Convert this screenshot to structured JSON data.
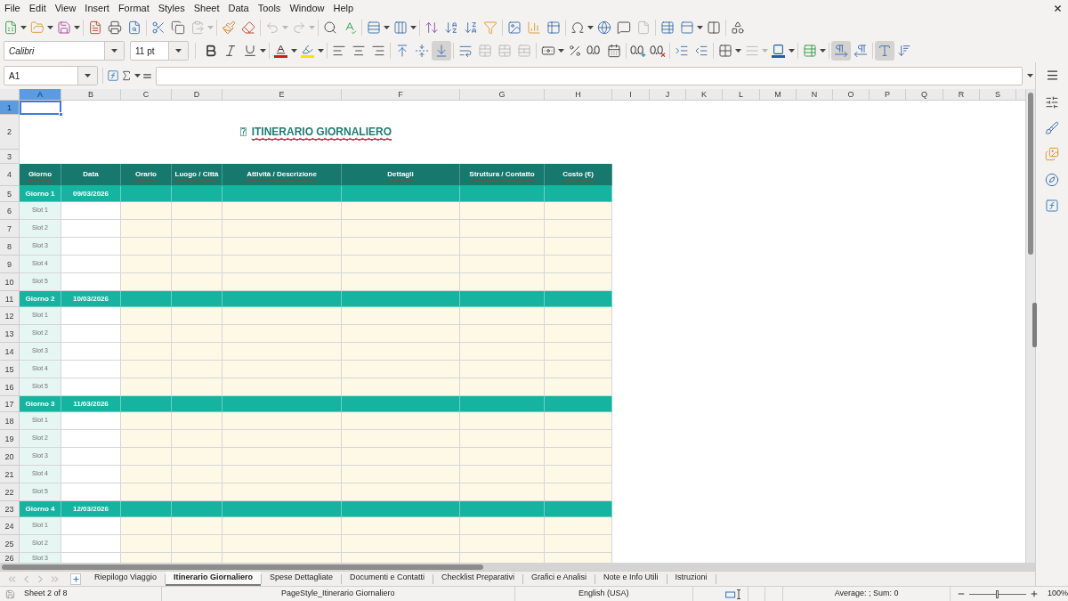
{
  "menu_bar": {
    "items": [
      "File",
      "Edit",
      "View",
      "Insert",
      "Format",
      "Styles",
      "Sheet",
      "Data",
      "Tools",
      "Window",
      "Help"
    ]
  },
  "standard_toolbar": {
    "paste": {
      "disabled": true
    },
    "undo": {
      "disabled": true
    },
    "redo": {
      "disabled": true
    },
    "headers_and_footers": {
      "disabled": true
    }
  },
  "formatting_toolbar": {
    "font_name": "Calibri",
    "font_size": "11 pt",
    "merge_cells": {
      "disabled": true
    },
    "border_style": {
      "disabled": true
    },
    "vertical_align": [
      {
        "selected": false
      },
      {
        "selected": false
      },
      {
        "selected": true
      }
    ],
    "paragraph_direction": [
      {
        "selected": true
      },
      {
        "selected": false
      }
    ],
    "text_orientation": [
      {
        "selected": true
      },
      {
        "selected": false
      }
    ]
  },
  "formula_bar": {
    "name_box": "A1"
  },
  "sheet": {
    "columns": [
      {
        "label": "A",
        "selected": true
      },
      {
        "label": "B",
        "selected": false
      },
      {
        "label": "C",
        "selected": false
      },
      {
        "label": "D",
        "selected": false
      },
      {
        "label": "E",
        "selected": false
      },
      {
        "label": "F",
        "selected": false
      },
      {
        "label": "G",
        "selected": false
      },
      {
        "label": "H",
        "selected": false
      },
      {
        "label": "I",
        "selected": false
      },
      {
        "label": "J",
        "selected": false
      },
      {
        "label": "K",
        "selected": false
      },
      {
        "label": "L",
        "selected": false
      },
      {
        "label": "M",
        "selected": false
      },
      {
        "label": "N",
        "selected": false
      },
      {
        "label": "O",
        "selected": false
      },
      {
        "label": "P",
        "selected": false
      },
      {
        "label": "Q",
        "selected": false
      },
      {
        "label": "R",
        "selected": false
      },
      {
        "label": "S",
        "selected": false
      }
    ],
    "rows": [
      {
        "number": "1",
        "selected": true,
        "kind": "blank"
      },
      {
        "number": "2",
        "selected": false,
        "kind": "title",
        "glyph": "⍰",
        "title": "ITINERARIO GIORNALIERO",
        "misspelled": true
      },
      {
        "number": "3",
        "selected": false,
        "kind": "blank"
      },
      {
        "number": "4",
        "selected": false,
        "kind": "header",
        "cells": [
          {
            "text": "Giorno",
            "misspelled": true
          },
          {
            "text": "Data",
            "misspelled": false
          },
          {
            "text": "Orario",
            "misspelled": true
          },
          {
            "text": "Luogo / Città",
            "misspelled": true
          },
          {
            "text": "Attività / Descrizione",
            "misspelled": true
          },
          {
            "text": "Dettagli",
            "misspelled": true
          },
          {
            "text": "Struttura / Contatto",
            "misspelled": true
          },
          {
            "text": "Costo (€)",
            "misspelled": true
          }
        ]
      },
      {
        "number": "5",
        "selected": false,
        "kind": "day",
        "day": "Giorno 1",
        "date": "09/03/2026"
      },
      {
        "number": "6",
        "selected": false,
        "kind": "slot",
        "slot": "Slot 1"
      },
      {
        "number": "7",
        "selected": false,
        "kind": "slot",
        "slot": "Slot 2"
      },
      {
        "number": "8",
        "selected": false,
        "kind": "slot",
        "slot": "Slot 3"
      },
      {
        "number": "9",
        "selected": false,
        "kind": "slot",
        "slot": "Slot 4"
      },
      {
        "number": "10",
        "selected": false,
        "kind": "slot",
        "slot": "Slot 5"
      },
      {
        "number": "11",
        "selected": false,
        "kind": "day",
        "day": "Giorno 2",
        "date": "10/03/2026"
      },
      {
        "number": "12",
        "selected": false,
        "kind": "slot",
        "slot": "Slot 1"
      },
      {
        "number": "13",
        "selected": false,
        "kind": "slot",
        "slot": "Slot 2"
      },
      {
        "number": "14",
        "selected": false,
        "kind": "slot",
        "slot": "Slot 3"
      },
      {
        "number": "15",
        "selected": false,
        "kind": "slot",
        "slot": "Slot 4"
      },
      {
        "number": "16",
        "selected": false,
        "kind": "slot",
        "slot": "Slot 5"
      },
      {
        "number": "17",
        "selected": false,
        "kind": "day",
        "day": "Giorno 3",
        "date": "11/03/2026"
      },
      {
        "number": "18",
        "selected": false,
        "kind": "slot",
        "slot": "Slot 1"
      },
      {
        "number": "19",
        "selected": false,
        "kind": "slot",
        "slot": "Slot 2"
      },
      {
        "number": "20",
        "selected": false,
        "kind": "slot",
        "slot": "Slot 3"
      },
      {
        "number": "21",
        "selected": false,
        "kind": "slot",
        "slot": "Slot 4"
      },
      {
        "number": "22",
        "selected": false,
        "kind": "slot",
        "slot": "Slot 5"
      },
      {
        "number": "23",
        "selected": false,
        "kind": "day",
        "day": "Giorno 4",
        "date": "12/03/2026"
      },
      {
        "number": "24",
        "selected": false,
        "kind": "slot",
        "slot": "Slot 1"
      },
      {
        "number": "25",
        "selected": false,
        "kind": "slot",
        "slot": "Slot 2"
      },
      {
        "number": "26",
        "selected": false,
        "kind": "slot",
        "slot": "Slot 3"
      }
    ]
  },
  "sheet_tabs": {
    "navigation": [
      {
        "disabled": true
      },
      {
        "disabled": true
      },
      {
        "disabled": true
      },
      {
        "disabled": true
      }
    ],
    "tabs": [
      {
        "label": "Riepilogo Viaggio",
        "selected": false
      },
      {
        "label": "Itinerario Giornaliero",
        "selected": true
      },
      {
        "label": "Spese Dettagliate",
        "selected": false
      },
      {
        "label": "Documenti e Contatti",
        "selected": false
      },
      {
        "label": "Checklist Preparativi",
        "selected": false
      },
      {
        "label": "Grafici e Analisi",
        "selected": false
      },
      {
        "label": "Note e Info Utili",
        "selected": false
      },
      {
        "label": "Istruzioni",
        "selected": false
      }
    ]
  },
  "status_bar": {
    "sheet_position": "Sheet 2 of 8",
    "page_style": "PageStyle_Itinerario Giornaliero",
    "language": "English (USA)",
    "selection_summary": "Average: ; Sum: 0",
    "zoom_slider": {
      "level": 0.5
    },
    "zoom": "100%"
  }
}
